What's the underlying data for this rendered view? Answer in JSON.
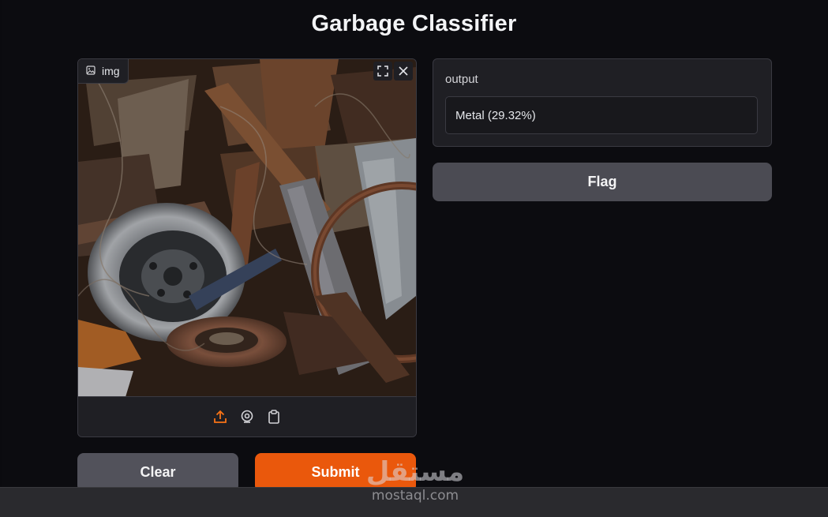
{
  "app": {
    "title": "Garbage Classifier"
  },
  "input_panel": {
    "label": "img",
    "label_icon": "image-icon",
    "top_icons": [
      "fullscreen-icon",
      "close-icon"
    ],
    "image_description_icon": "photo",
    "toolbar_icons": [
      "upload-icon",
      "webcam-icon",
      "clipboard-icon"
    ]
  },
  "buttons": {
    "clear": "Clear",
    "submit": "Submit",
    "flag": "Flag"
  },
  "output_panel": {
    "label": "output",
    "value": "Metal (29.32%)"
  },
  "watermark": {
    "arabic": "مستقل",
    "latin": "mostaql.com"
  },
  "colors": {
    "background": "#0c0c10",
    "panel": "#1f1f24",
    "accent": "#ea580c",
    "secondary_button": "#52525b"
  }
}
